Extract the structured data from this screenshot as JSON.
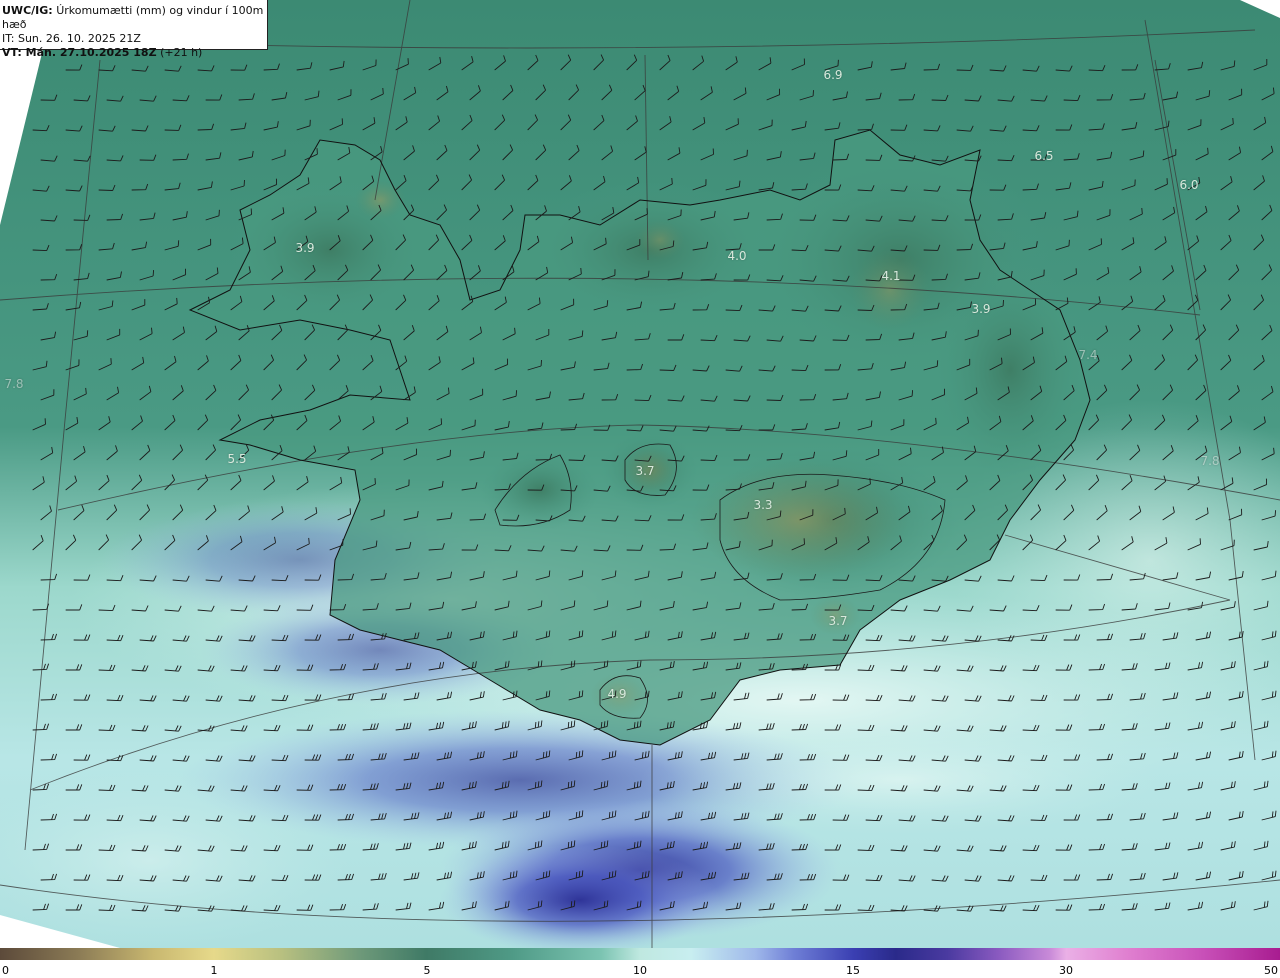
{
  "header": {
    "product_code": "UWC/IG:",
    "product_title": "Úrkomumætti (mm) og vindur í 100m hæð",
    "initial_time": "IT: Sun. 26. 10. 2025 21Z",
    "valid_time_bold": "VT: Mán. 27.10.2025 18Z",
    "valid_offset": "(+21 h)"
  },
  "map_labels": [
    {
      "text": "6.9"
    },
    {
      "text": "6.5"
    },
    {
      "text": "6.0"
    },
    {
      "text": "3.9"
    },
    {
      "text": "4.0"
    },
    {
      "text": "4.1"
    },
    {
      "text": "3.9"
    },
    {
      "text": "7.4"
    },
    {
      "text": "7.8"
    },
    {
      "text": "5.5"
    },
    {
      "text": "3.7"
    },
    {
      "text": "3.3"
    },
    {
      "text": "7.8"
    },
    {
      "text": "3.7"
    },
    {
      "text": "4.9"
    }
  ],
  "colorbar": {
    "ticks": [
      "0",
      "1",
      "5",
      "10",
      "15",
      "30",
      "50"
    ],
    "colors": {
      "land_high": "#8f8a55",
      "land_mid": "#3f7a66",
      "sea_light": "#c4ece8",
      "heavy_precip": "#2a2a8a"
    }
  },
  "icons": [
    "wind-barb-icon",
    "coastline",
    "graticule-line"
  ]
}
